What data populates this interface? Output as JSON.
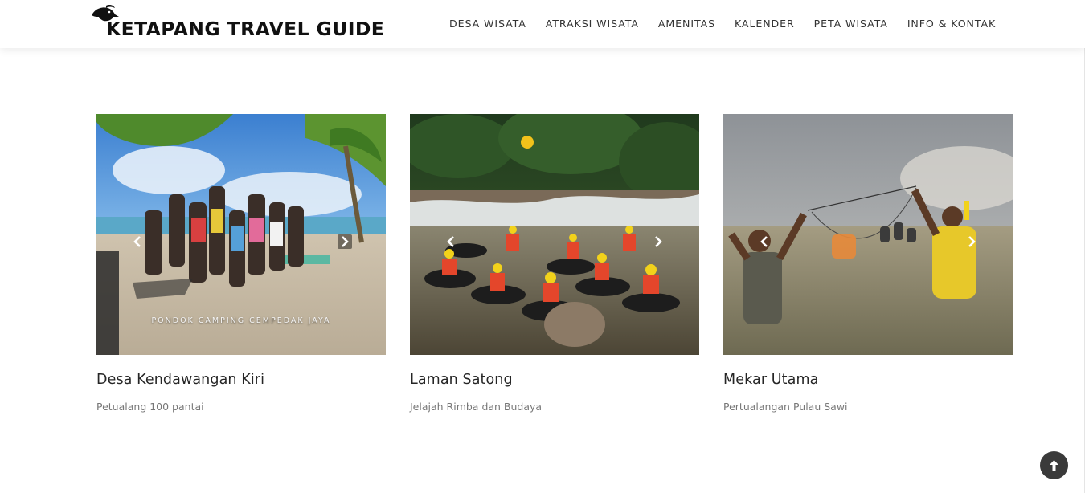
{
  "header": {
    "logo_text": "KETAPANG TRAVEL GUIDE",
    "nav": [
      {
        "label": "DESA WISATA"
      },
      {
        "label": "ATRAKSI WISATA"
      },
      {
        "label": "AMENITAS"
      },
      {
        "label": "KALENDER"
      },
      {
        "label": "PETA WISATA"
      },
      {
        "label": "INFO & KONTAK"
      }
    ]
  },
  "cards": [
    {
      "title": "Desa Kendawangan Kiri",
      "subtitle": "Petualang 100 pantai",
      "image_caption": "PONDOK CAMPING CEMPEDAK JAYA",
      "prev_icon": "chevron-left-icon",
      "next_icon": "chevron-right-icon"
    },
    {
      "title": "Laman Satong",
      "subtitle": "Jelajah Rimba dan Budaya",
      "prev_icon": "chevron-left-icon",
      "next_icon": "chevron-right-icon"
    },
    {
      "title": "Mekar Utama",
      "subtitle": "Pertualangan Pulau Sawi",
      "prev_icon": "chevron-left-icon",
      "next_icon": "chevron-right-icon"
    }
  ],
  "scroll_top": {
    "icon": "arrow-up-icon"
  },
  "colors": {
    "nav_text": "#333333",
    "title_text": "#262626",
    "subtitle_text": "#777777",
    "scroll_button": "#3a3a3a"
  }
}
